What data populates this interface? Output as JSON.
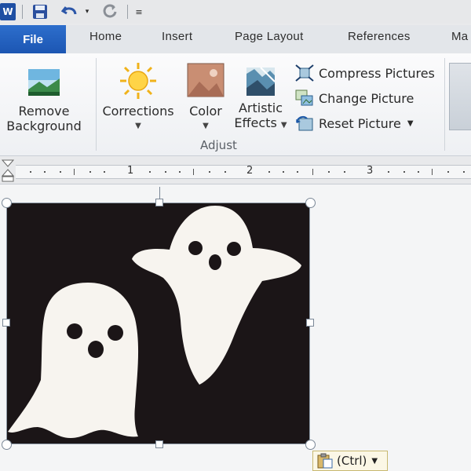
{
  "app": {
    "logo_letter": "W"
  },
  "quick_access": {
    "icons": [
      "save-icon",
      "undo-icon",
      "redo-icon",
      "customize-icon"
    ]
  },
  "tabs": {
    "file": "File",
    "items": [
      "Home",
      "Insert",
      "Page Layout",
      "References",
      "Ma"
    ]
  },
  "ribbon": {
    "adjust_group": {
      "label": "Adjust",
      "remove_background": {
        "line1": "Remove",
        "line2": "Background"
      },
      "corrections": {
        "label": "Corrections"
      },
      "color": {
        "label": "Color"
      },
      "artistic_effects": {
        "line1": "Artistic",
        "line2": "Effects"
      },
      "compress_pictures": "Compress Pictures",
      "change_picture": "Change Picture",
      "reset_picture": "Reset Picture"
    }
  },
  "ruler": {
    "numbers": [
      "1",
      "2",
      "3"
    ]
  },
  "paste_options": {
    "label": "(Ctrl)"
  },
  "colors": {
    "file_tab": "#1f5fbf",
    "picture_bg": "#1b1517",
    "ghost": "#f7f4ef"
  }
}
